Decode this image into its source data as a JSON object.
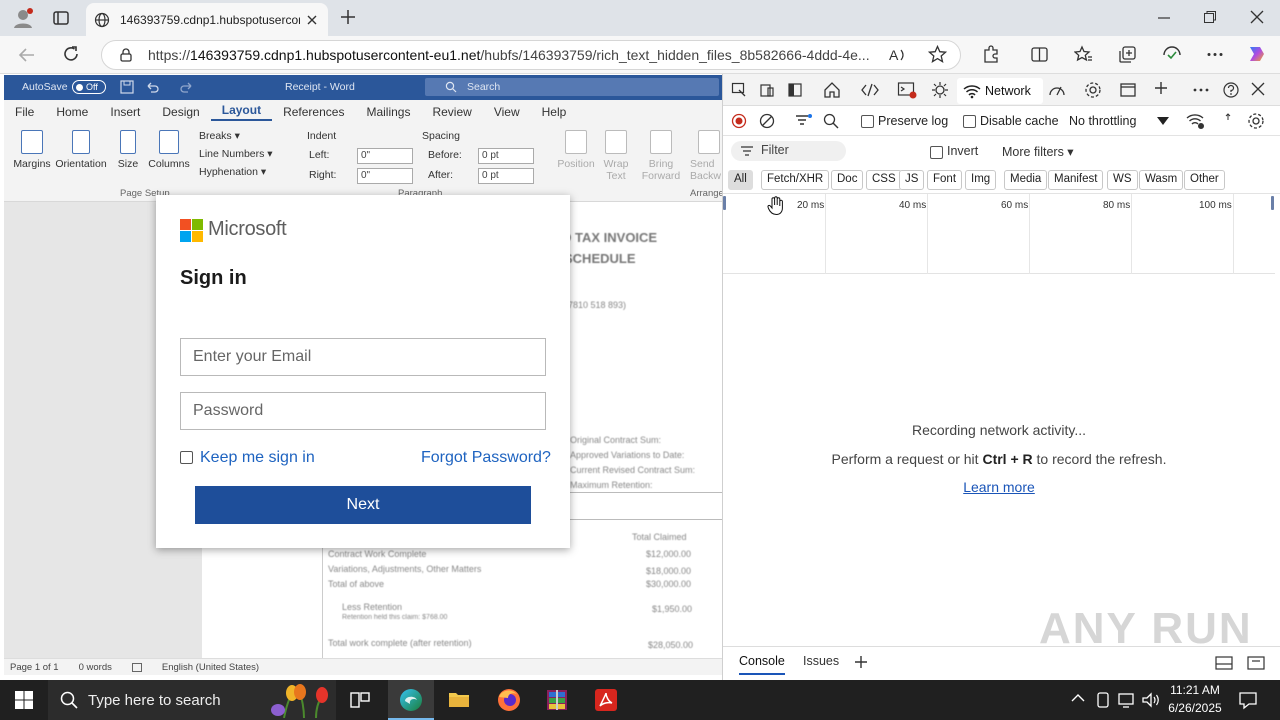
{
  "browser": {
    "tab_title": "146393759.cdnp1.hubspotusercon",
    "url_prefix": "https://",
    "url_domain": "146393759.cdnp1.hubspotusercontent-eu1.net",
    "url_path": "/hubfs/146393759/rich_text_hidden_files_8b582666-4ddd-4e..."
  },
  "word": {
    "autosave_label": "AutoSave",
    "autosave_state": "Off",
    "doc_title": "Receipt - Word",
    "search_placeholder": "Search",
    "menu": [
      "File",
      "Home",
      "Insert",
      "Design",
      "Layout",
      "References",
      "Mailings",
      "Review",
      "View",
      "Help"
    ],
    "active_menu": "Layout",
    "ribbon": {
      "margins": "Margins",
      "orientation": "Orientation",
      "size": "Size",
      "columns": "Columns",
      "breaks": "Breaks",
      "line_numbers": "Line Numbers",
      "hyphenation": "Hyphenation",
      "group_page_setup": "Page Setup",
      "group_paragraph": "Paragraph",
      "group_arrange": "Arrange",
      "indent": "Indent",
      "left": "Left:",
      "right": "Right:",
      "indent_left_val": "0\"",
      "indent_right_val": "0\"",
      "spacing": "Spacing",
      "before": "Before:",
      "after": "After:",
      "before_val": "0 pt",
      "after_val": "0 pt",
      "position": "Position",
      "wrap_text": "Wrap Text",
      "bring_forward": "Bring Forward",
      "send_backward": "Send Backw"
    },
    "document": {
      "heading1": "D TAX INVOICE",
      "heading2": "SCHEDULE",
      "abn": "7810 518 893)",
      "side_labels": [
        "Original Contract Sum:",
        "Approved Variations to Date:",
        "Current Revised Contract Sum:",
        "Maximum Retention:"
      ],
      "total_claimed": "Total Claimed",
      "rows": [
        {
          "label": "Contract Work Complete",
          "value": "$12,000.00"
        },
        {
          "label": "Variations, Adjustments, Other Matters",
          "value": "$18,000.00"
        },
        {
          "label": "Total of above",
          "value": "$30,000.00"
        },
        {
          "label": "Less Retention",
          "value": "$1,950.00"
        },
        {
          "label": "Retention held this claim: $768.00",
          "value": ""
        },
        {
          "label": "Total work complete (after retention)",
          "value": "$28,050.00"
        }
      ]
    },
    "status": {
      "page": "Page 1 of 1",
      "words": "0 words",
      "language": "English (United States)"
    }
  },
  "modal": {
    "brand": "Microsoft",
    "heading": "Sign in",
    "email_placeholder": "Enter your Email",
    "password_placeholder": "Password",
    "keep_signed_in": "Keep me sign in",
    "forgot": "Forgot Password?",
    "next": "Next",
    "logo_colors": [
      "#f25022",
      "#7fba00",
      "#00a4ef",
      "#ffb900"
    ]
  },
  "devtools": {
    "network_tab": "Network",
    "preserve_log": "Preserve log",
    "disable_cache": "Disable cache",
    "throttling": "No throttling",
    "filter_placeholder": "Filter",
    "invert": "Invert",
    "more_filters": "More filters",
    "types": [
      "All",
      "Fetch/XHR",
      "Doc",
      "CSS",
      "JS",
      "Font",
      "Img",
      "Media",
      "Manifest",
      "WS",
      "Wasm",
      "Other"
    ],
    "ticks": [
      "20 ms",
      "40 ms",
      "60 ms",
      "80 ms",
      "100 ms"
    ],
    "recording": "Recording network activity...",
    "hint_pre": "Perform a request or hit ",
    "hint_keys": "Ctrl + R",
    "hint_post": " to record the refresh.",
    "learn_more": "Learn more",
    "bottom_tabs": [
      "Console",
      "Issues"
    ]
  },
  "taskbar": {
    "search_placeholder": "Type here to search",
    "time": "11:21 AM",
    "date": "6/26/2025"
  },
  "watermark": "ANY RUN"
}
